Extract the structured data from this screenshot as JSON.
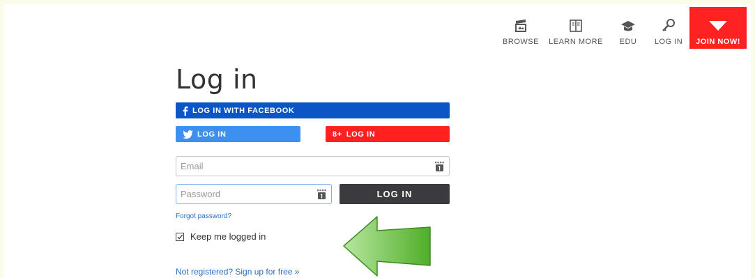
{
  "nav": {
    "items": [
      {
        "label": "BROWSE",
        "icon": "browse-icon"
      },
      {
        "label": "LEARN MORE",
        "icon": "book-icon"
      },
      {
        "label": "EDU",
        "icon": "graduation-cap-icon"
      },
      {
        "label": "LOG IN",
        "icon": "key-icon"
      }
    ],
    "join": {
      "label": "JOIN NOW!",
      "icon": "triangle-down-icon"
    }
  },
  "login": {
    "title": "Log in",
    "facebook_label": "LOG IN WITH FACEBOOK",
    "twitter_label": "LOG IN",
    "google_label": "LOG IN",
    "google_glyph": "8+",
    "email_placeholder": "Email",
    "password_placeholder": "Password",
    "submit_label": "LOG IN",
    "forgot_label": "Forgot password?",
    "keep_label": "Keep me logged in",
    "keep_checked": true,
    "signup_label": "Not registered? Sign up for free »"
  },
  "colors": {
    "facebook": "#0b55c4",
    "twitter": "#3d8ff0",
    "google": "#ff2020",
    "join": "#ff2222",
    "submit": "#3a3a3f",
    "link": "#2b6cc4",
    "arrow": "#5cb82f"
  }
}
